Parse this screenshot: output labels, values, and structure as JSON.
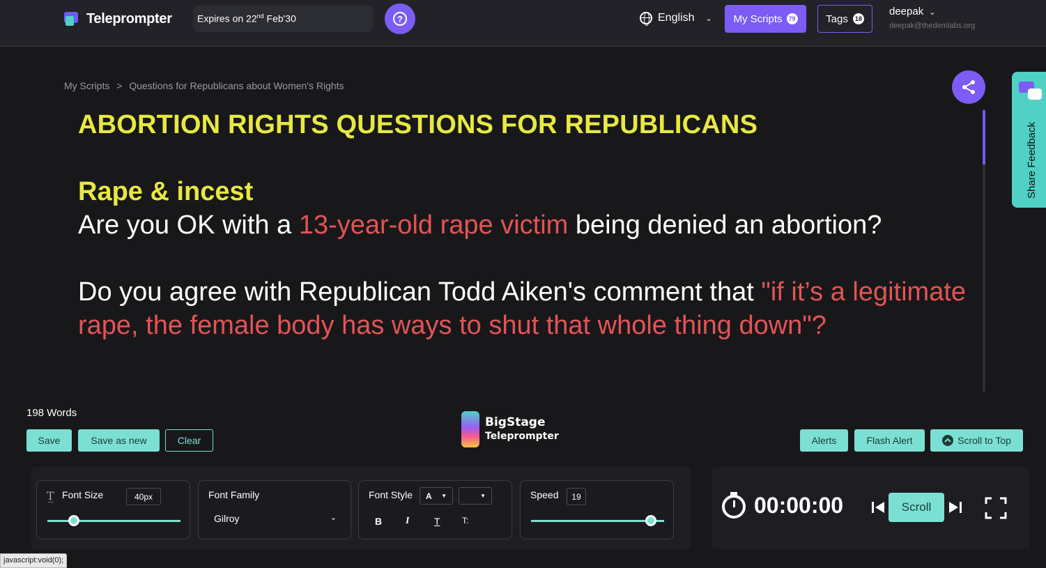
{
  "header": {
    "app_name": "Teleprompter",
    "expiry_prefix": "Expires on 22",
    "expiry_sup": "nd",
    "expiry_suffix": " Feb'30",
    "language": "English",
    "my_scripts_label": "My Scripts",
    "my_scripts_count": "79",
    "tags_label": "Tags",
    "tags_count": "18",
    "user_name": "deepak",
    "user_email": "deepak@thedemlabs.org"
  },
  "breadcrumb": {
    "root": "My Scripts",
    "separator": ">",
    "current": "Questions for Republicans about Women's Rights"
  },
  "script": {
    "title": "ABORTION RIGHTS QUESTIONS FOR REPUBLICANS",
    "section_heading": "Rape & incest",
    "q1_before": "Are you OK with a ",
    "q1_highlight": "13-year-old rape victim",
    "q1_after": " being denied an abortion?",
    "q2_before": "Do you agree with Republican Todd Aiken's comment that ",
    "q2_highlight": "\"if it’s a legitimate rape, the female body has ways to shut that whole thing down\"?"
  },
  "feedback_tab": {
    "label": "Share Feedback"
  },
  "editor": {
    "word_count": "198 Words",
    "save_label": "Save",
    "save_as_new_label": "Save as new",
    "clear_label": "Clear",
    "alerts_label": "Alerts",
    "flash_alert_label": "Flash Alert",
    "scroll_to_top_label": "Scroll to Top"
  },
  "brand": {
    "line1": "BigStage",
    "line2": "Teleprompter"
  },
  "controls": {
    "font_size_label": "Font Size",
    "font_size_value": "40px",
    "font_size_level": 0.2,
    "font_family_label": "Font Family",
    "font_family_value": "Gilroy",
    "font_style_label": "Font Style",
    "font_style_select_value": "A",
    "font_style_select2_value": "",
    "bold_label": "B",
    "italic_label": "I",
    "strike_label": "T",
    "case_label": "T:",
    "speed_label": "Speed",
    "speed_value": "19",
    "speed_level": 0.9,
    "timer": "00:00:00",
    "scroll_label": "Scroll"
  },
  "status_bar": {
    "text": "javascript:void(0);"
  },
  "colors": {
    "accent_purple": "#7c5cf5",
    "accent_teal": "#7be0d3",
    "title_yellow": "#e8e842",
    "highlight_red": "#e35454"
  }
}
